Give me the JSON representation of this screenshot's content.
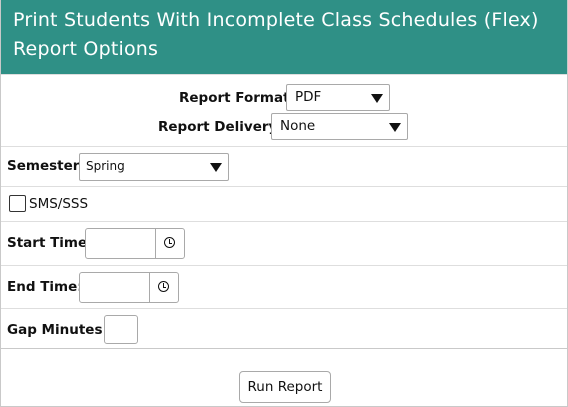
{
  "header": {
    "title_line1": "Print Students With Incomplete Class Schedules (Flex)",
    "title_line2": "Report Options"
  },
  "report_format": {
    "label": "Report Format:",
    "value": "PDF"
  },
  "report_delivery": {
    "label": "Report Delivery:",
    "value": "None"
  },
  "semester": {
    "label": "Semester:",
    "value": "Spring"
  },
  "sms_sss": {
    "label": "SMS/SSS",
    "checked": false
  },
  "start_time": {
    "label": "Start Time:",
    "value": ""
  },
  "end_time": {
    "label": "End Time:",
    "value": ""
  },
  "gap_minutes": {
    "label": "Gap Minutes:",
    "value": ""
  },
  "run_button": {
    "label": "Run Report"
  },
  "colors": {
    "header_bg": "#2f9086",
    "header_text": "#ffffff"
  },
  "icons": {
    "time_picker": "clock-icon",
    "dropdown": "chevron-down-icon"
  }
}
